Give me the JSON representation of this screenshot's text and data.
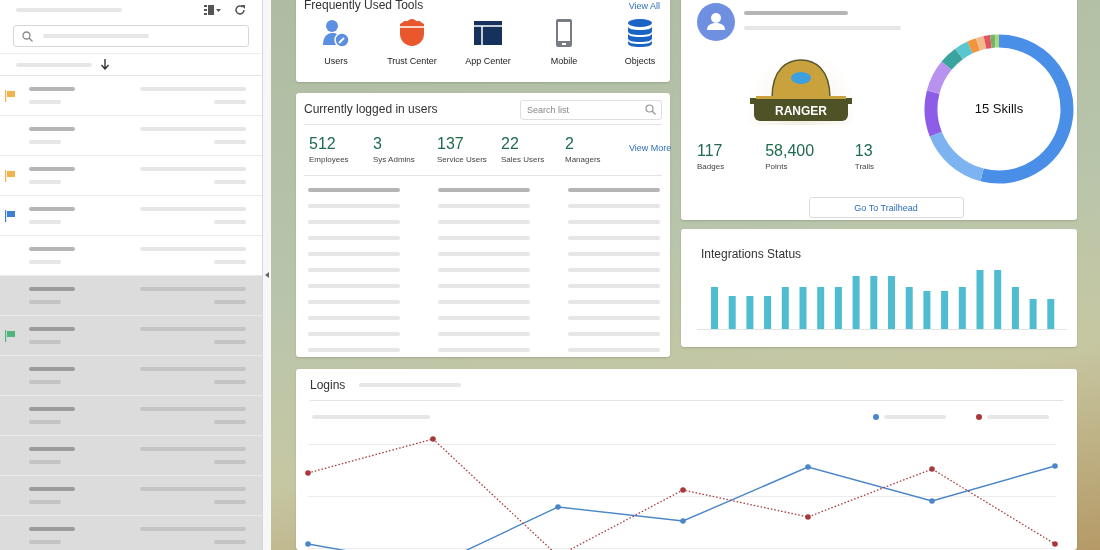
{
  "sidebar": {
    "rows": [
      {
        "color": "#f0b24e",
        "shaded": false
      },
      {
        "shaded": false
      },
      {
        "color": "#f0b24e",
        "shaded": false
      },
      {
        "color": "#3d7fd0",
        "shaded": false
      },
      {
        "shaded": false
      },
      {
        "shaded": true
      },
      {
        "color": "#4fb57a",
        "shaded": true
      },
      {
        "shaded": true
      },
      {
        "shaded": true
      },
      {
        "shaded": true
      },
      {
        "shaded": true
      },
      {
        "shaded": true
      }
    ]
  },
  "tools": {
    "title": "Frequently Used Tools",
    "link": "View All",
    "items": [
      {
        "label": "Users",
        "kind": "users"
      },
      {
        "label": "Trust Center",
        "kind": "shield"
      },
      {
        "label": "App Center",
        "kind": "layout"
      },
      {
        "label": "Mobile",
        "kind": "phone"
      },
      {
        "label": "Objects",
        "kind": "database"
      }
    ]
  },
  "logged_in": {
    "title": "Currently logged in users",
    "search": {
      "placeholder": "Search list"
    },
    "stats": [
      {
        "value": "512",
        "label": "Employees"
      },
      {
        "value": "3",
        "label": "Sys Admins"
      },
      {
        "value": "137",
        "label": "Service Users"
      },
      {
        "value": "22",
        "label": "Sales Users"
      },
      {
        "value": "2",
        "label": "Managers"
      }
    ],
    "link": "View More"
  },
  "profile": {
    "badge_label": "RANGER",
    "stats": [
      {
        "value": "117",
        "label": "Badges"
      },
      {
        "value": "58,400",
        "label": "Points"
      },
      {
        "value": "13",
        "label": "Trails"
      }
    ],
    "donut_label": "15 Skills",
    "button": "Go To Trailhead"
  },
  "integrations": {
    "title": "Integrations Status"
  },
  "logins": {
    "title": "Logins",
    "legend": [
      {
        "color": "#4a86c8"
      },
      {
        "color": "#a8383a"
      }
    ]
  }
}
